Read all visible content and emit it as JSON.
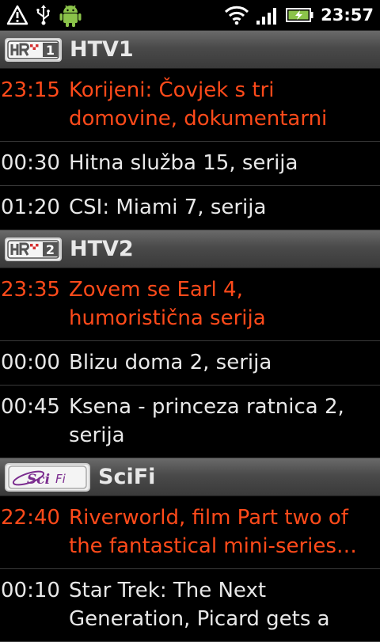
{
  "status_bar": {
    "time": "23:57",
    "icons": [
      "warning-icon",
      "usb-icon",
      "android-debug-icon",
      "wifi-icon",
      "signal-icon",
      "battery-charging-icon"
    ]
  },
  "channels": [
    {
      "logo_text": "HRT 1",
      "name": "HTV1",
      "programs": [
        {
          "time": "23:15",
          "title": "Korijeni: Čovjek s tri domovine, dokumentarni",
          "current": true
        },
        {
          "time": "00:30",
          "title": "Hitna služba 15, serija",
          "current": false
        },
        {
          "time": "01:20",
          "title": "CSI: Miami 7, serija",
          "current": false
        }
      ]
    },
    {
      "logo_text": "HRT 2",
      "name": "HTV2",
      "programs": [
        {
          "time": "23:35",
          "title": "Zovem se Earl 4, humoristična serija",
          "current": true
        },
        {
          "time": "00:00",
          "title": "Blizu doma 2, serija",
          "current": false
        },
        {
          "time": "00:45",
          "title": "Ksena - princeza ratnica 2, serija",
          "current": false
        }
      ]
    },
    {
      "logo_text": "Sci Fi",
      "name": "SciFi",
      "programs": [
        {
          "time": "22:40",
          "title": "Riverworld, film Part two of the fantastical mini-series…",
          "current": true
        },
        {
          "time": "00:10",
          "title": "Star Trek: The Next Generation, Picard gets a",
          "current": false
        }
      ]
    }
  ],
  "colors": {
    "current_program": "#ff4a1a",
    "program_text": "#e8e8e8",
    "background": "#000000"
  }
}
